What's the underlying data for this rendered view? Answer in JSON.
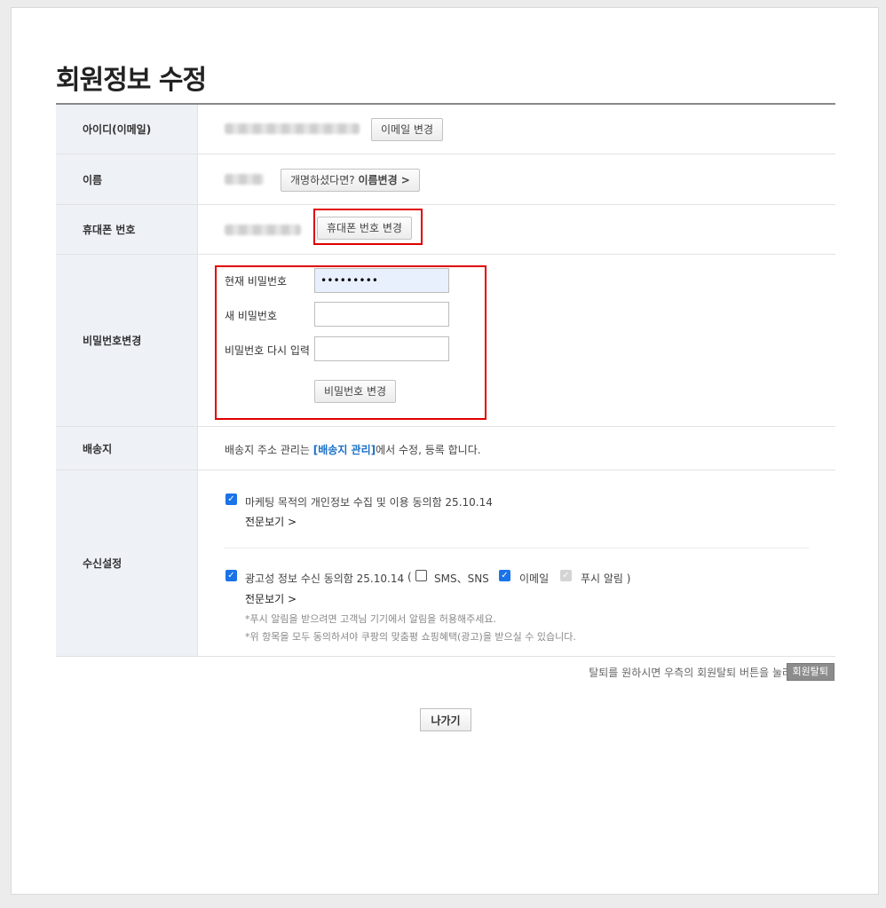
{
  "page": {
    "title": "회원정보 수정"
  },
  "rows": {
    "id": {
      "label": "아이디(이메일)",
      "button": "이메일 변경"
    },
    "name": {
      "label": "이름",
      "button_prefix": "개명하셨다면?",
      "button_bold": "이름변경 >"
    },
    "phone": {
      "label": "휴대폰 번호",
      "button": "휴대폰 번호 변경"
    },
    "password": {
      "label": "비밀번호변경",
      "current_label": "현재 비밀번호",
      "current_value": "•••••••••",
      "new_label": "새 비밀번호",
      "confirm_label": "비밀번호 다시 입력",
      "submit": "비밀번호 변경"
    },
    "shipping": {
      "label": "배송지",
      "text_before": "배송지 주소 관리는 ",
      "link": "[배송지 관리]",
      "text_after": "에서 수정, 등록 합니다."
    },
    "subscription": {
      "label": "수신설정",
      "marketing": {
        "text": "마케팅 목적의 개인정보 수집 및 이용 동의함 25.10.14",
        "checked": true
      },
      "more_1": "전문보기 >",
      "ad": {
        "text": "광고성 정보 수신 동의함 25.10.14",
        "checked": true
      },
      "paren_open": "(",
      "sms": {
        "text": "SMS、SNS",
        "checked": false
      },
      "email": {
        "text": "이메일",
        "checked": true
      },
      "push": {
        "text": "푸시 알림 )",
        "checked": true,
        "disabled": true
      },
      "more_2": "전문보기 >",
      "note_1": "*푸시 알림을 받으려면 고객님 기기에서 알림을 허용해주세요.",
      "note_2": "*위 항목을 모두 동의하셔야 쿠팡의 맞춤평 쇼핑혜택(광고)을 받으실 수 있습니다."
    }
  },
  "footer": {
    "withdraw_text": "탈퇴를 원하시면 우측의 회원탈퇴 버튼을 눌러주세요.",
    "withdraw_button": "회원탈퇴",
    "exit_button": "나가기"
  },
  "colors": {
    "highlight": "#e00000",
    "link": "#1b6fc6",
    "checkbox": "#1a73e8",
    "label_bg": "#eef1f6"
  }
}
